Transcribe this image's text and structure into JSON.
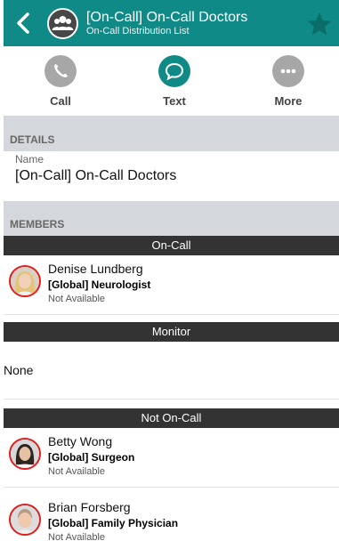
{
  "header": {
    "title": "[On-Call] On-Call Doctors",
    "subtitle": "On-Call Distribution List",
    "back_icon": "chevron-left-icon",
    "avatar_icon": "group-icon",
    "favorite_icon": "star-icon",
    "colors": {
      "bar": "#0f8a86"
    }
  },
  "actions": [
    {
      "label": "Call",
      "icon": "phone-icon",
      "active": false
    },
    {
      "label": "Text",
      "icon": "chat-bubble-icon",
      "active": true
    },
    {
      "label": "More",
      "icon": "ellipsis-icon",
      "active": false
    }
  ],
  "details": {
    "section_title": "DETAILS",
    "name_label": "Name",
    "name_value": "[On-Call] On-Call Doctors"
  },
  "members": {
    "section_title": "MEMBERS",
    "groups": [
      {
        "title": "On-Call",
        "people": [
          {
            "name": "Denise Lundberg",
            "role": "[Global] Neurologist",
            "status": "Not Available"
          }
        ]
      },
      {
        "title": "Monitor",
        "empty_text": "None"
      },
      {
        "title": "Not On-Call",
        "people": [
          {
            "name": "Betty Wong",
            "role": "[Global] Surgeon",
            "status": "Not Available"
          },
          {
            "name": "Brian Forsberg",
            "role": "[Global] Family Physician",
            "status": "Not Available"
          }
        ]
      }
    ]
  }
}
